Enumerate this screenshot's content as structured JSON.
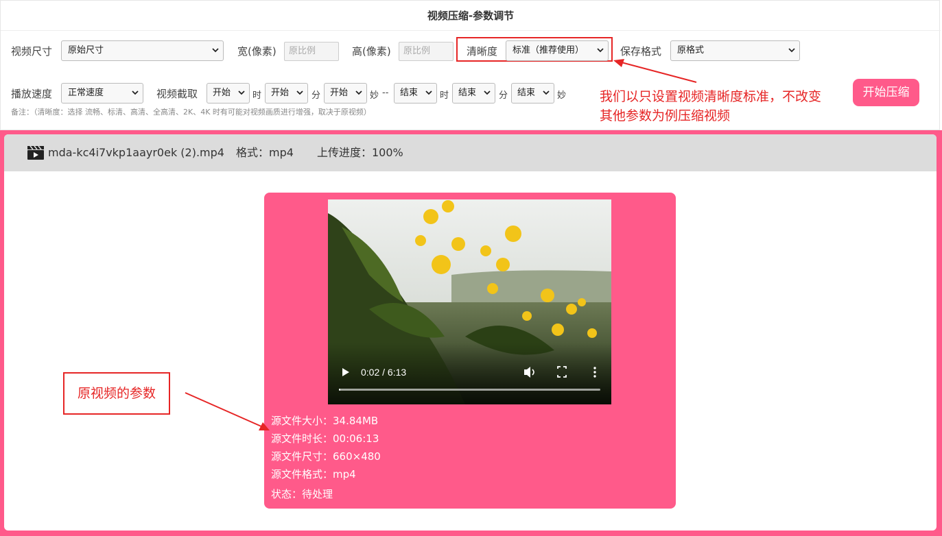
{
  "title": "视频压缩-参数调节",
  "params": {
    "size_label": "视频尺寸",
    "size_value": "原始尺寸",
    "width_label": "宽(像素)",
    "width_placeholder": "原比例",
    "height_label": "高(像素)",
    "height_placeholder": "原比例",
    "clarity_label": "清晰度",
    "clarity_value": "标准（推荐使用）",
    "format_label": "保存格式",
    "format_value": "原格式",
    "speed_label": "播放速度",
    "speed_value": "正常速度",
    "clip_label": "视频截取",
    "clip_start_h": "开始",
    "clip_start_m": "开始",
    "clip_start_s": "开始",
    "unit_hour": "时",
    "unit_min": "分",
    "unit_sec": "妙",
    "separator": "--",
    "clip_end_h": "结束",
    "clip_end_m": "结束",
    "clip_end_s": "结束",
    "note": "备注：（清晰度：选择 流畅、标清、高清、全高清、2K、4K 时有可能对视频画质进行增强，取决于原视频）"
  },
  "start_button": "开始压缩",
  "annotation_top_line1": "我们以只设置视频清晰度标准，不改变",
  "annotation_top_line2": "其他参数为例压缩视频",
  "annotation_left": "原视频的参数",
  "file": {
    "icon": "film-clapper-icon",
    "name": "mda-kc4i7vkp1aayr0ek (2).mp4",
    "format_text": "格式：mp4",
    "progress_text": "上传进度：100%"
  },
  "video": {
    "time": "0:02 / 6:13",
    "progress_fraction": 0.005
  },
  "source_info": {
    "size": "源文件大小：34.84MB",
    "duration": "源文件时长：00:06:13",
    "dimensions": "源文件尺寸：660×480",
    "format": "源文件格式：mp4",
    "status": "状态：待处理"
  },
  "colors": {
    "accent_pink": "#ff5a8a",
    "annotation_red": "#e62525"
  }
}
